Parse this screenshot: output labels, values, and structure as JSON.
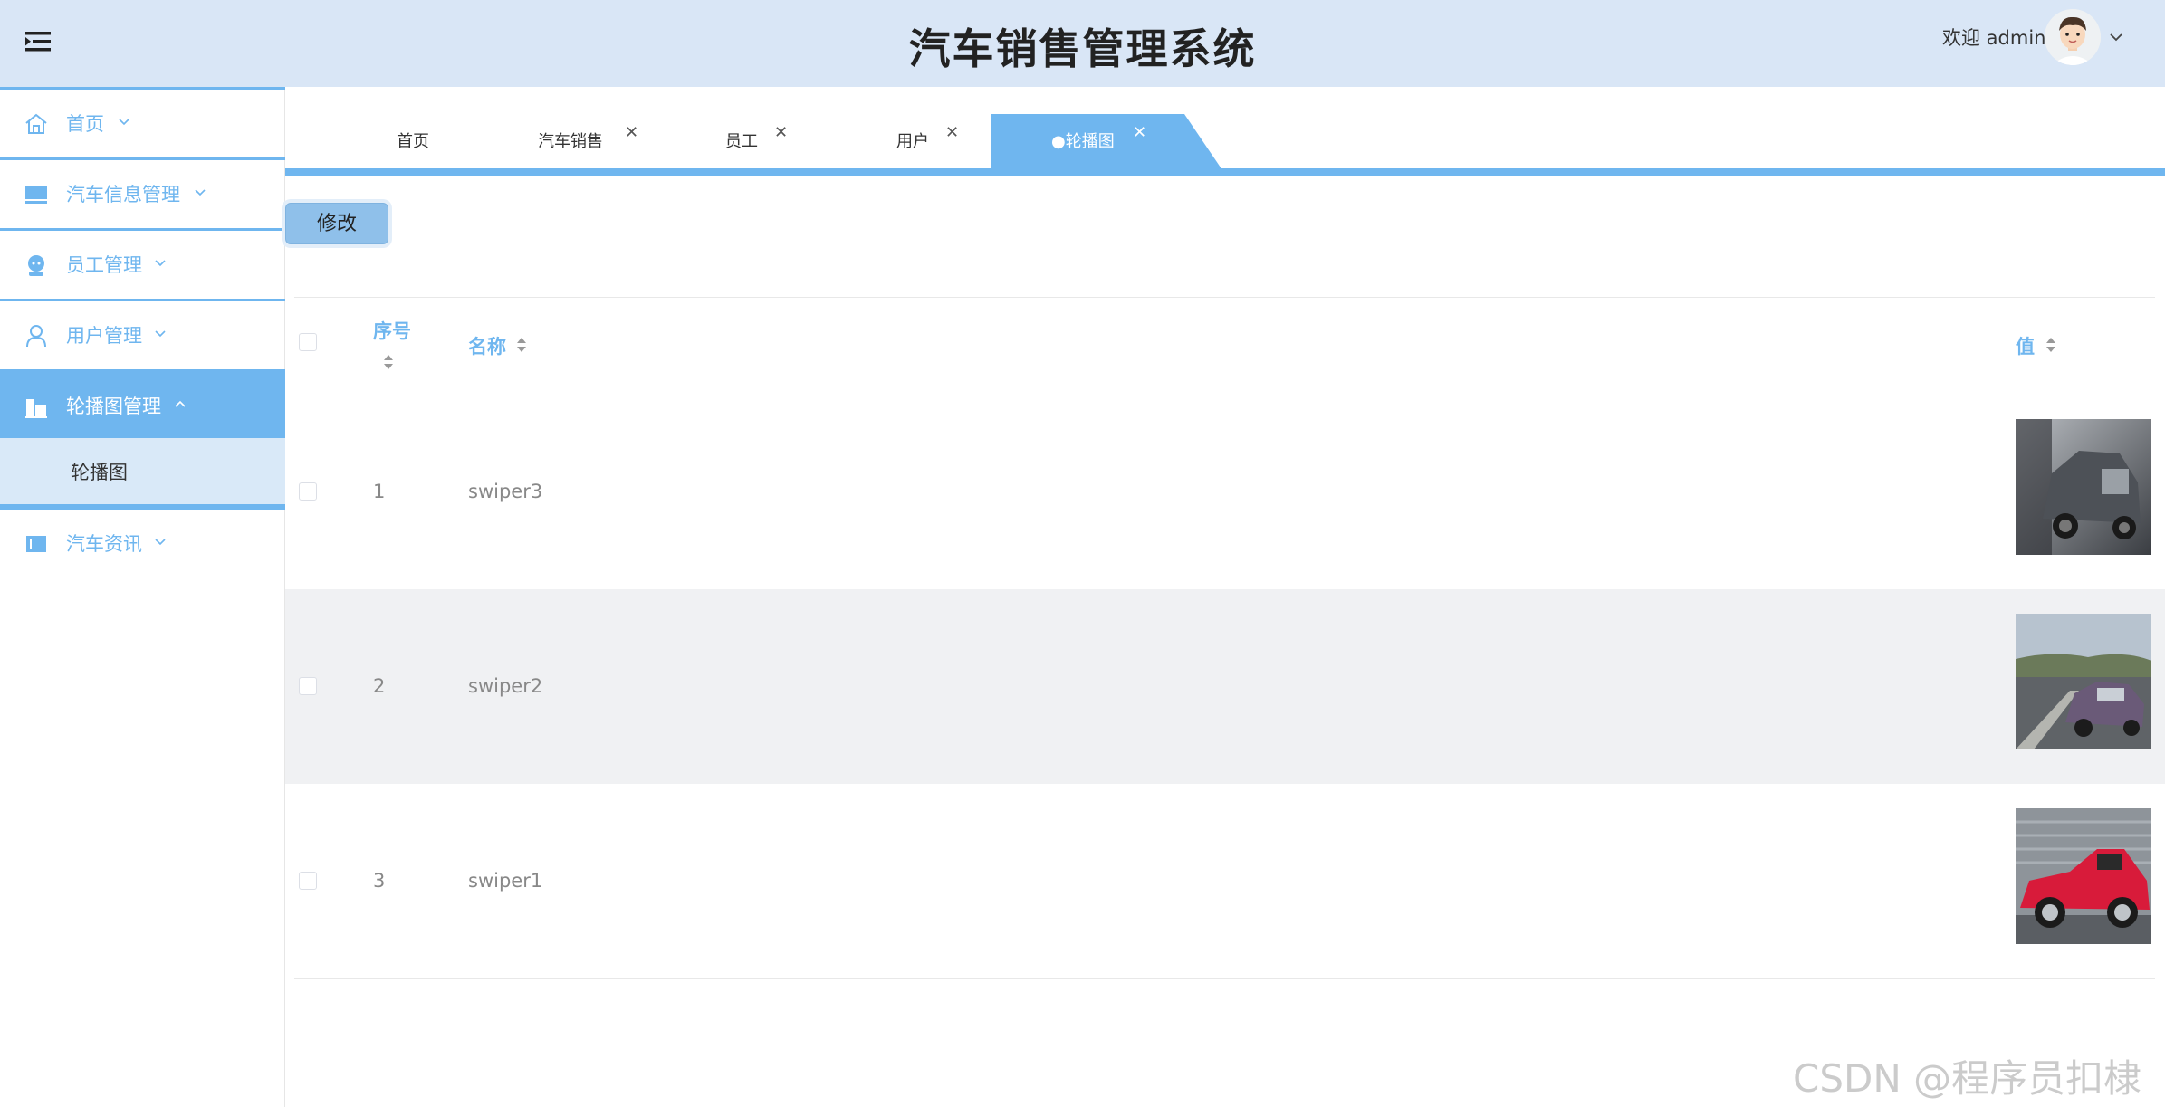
{
  "header": {
    "title": "汽车销售管理系统",
    "welcome": "欢迎 admin"
  },
  "sidebar": {
    "items": [
      {
        "label": "首页",
        "icon": "home-icon"
      },
      {
        "label": "汽车信息管理",
        "icon": "monitor-icon"
      },
      {
        "label": "员工管理",
        "icon": "staff-icon"
      },
      {
        "label": "用户管理",
        "icon": "user-icon"
      },
      {
        "label": "轮播图管理",
        "icon": "building-icon",
        "active": true
      },
      {
        "label": "汽车资讯",
        "icon": "book-icon"
      }
    ],
    "submenu": {
      "label": "轮播图"
    }
  },
  "tabs": [
    {
      "label": "首页",
      "closable": false
    },
    {
      "label": "汽车销售",
      "closable": true
    },
    {
      "label": "员工",
      "closable": true
    },
    {
      "label": "用户",
      "closable": true
    },
    {
      "label": "●轮播图",
      "closable": true,
      "active": true
    }
  ],
  "toolbar": {
    "edit_label": "修改"
  },
  "table": {
    "headers": {
      "index": "序号",
      "name": "名称",
      "value": "值"
    },
    "rows": [
      {
        "index": "1",
        "name": "swiper3",
        "image": "car-image-dark-sedan"
      },
      {
        "index": "2",
        "name": "swiper2",
        "image": "car-image-purple-coupe"
      },
      {
        "index": "3",
        "name": "swiper1",
        "image": "car-image-red-sportscar"
      }
    ]
  },
  "watermark": "CSDN @程序员扣棣",
  "colors": {
    "accent": "#6fb6ef",
    "header_bg": "#d9e6f6",
    "submenu_bg": "#d9e9f8",
    "stripe": "#f0f1f3"
  }
}
